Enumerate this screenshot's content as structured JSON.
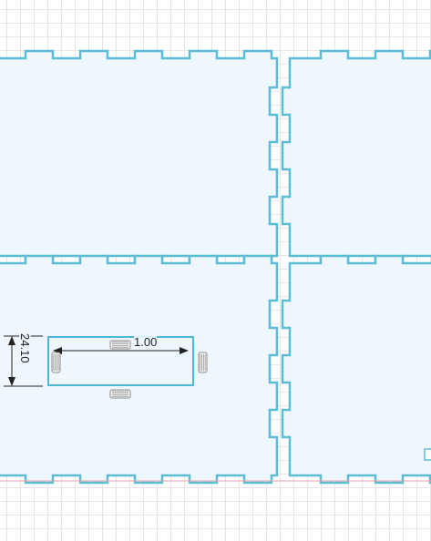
{
  "canvas": {
    "grid_color": "#e6e6e6",
    "panel_fill": "#eef7fd",
    "panel_stroke": "#5bbcd6",
    "selection_stroke": "#4fb6d3",
    "dimension_color": "#222222",
    "baseline_color": "#e9a0a0"
  },
  "selection": {
    "width_label": "1.00",
    "height_label": "24.10"
  },
  "icons": {
    "top": "resize-handle-horizontal-icon",
    "bottom": "resize-handle-horizontal-icon",
    "left": "resize-handle-vertical-icon",
    "right": "resize-handle-vertical-icon"
  }
}
